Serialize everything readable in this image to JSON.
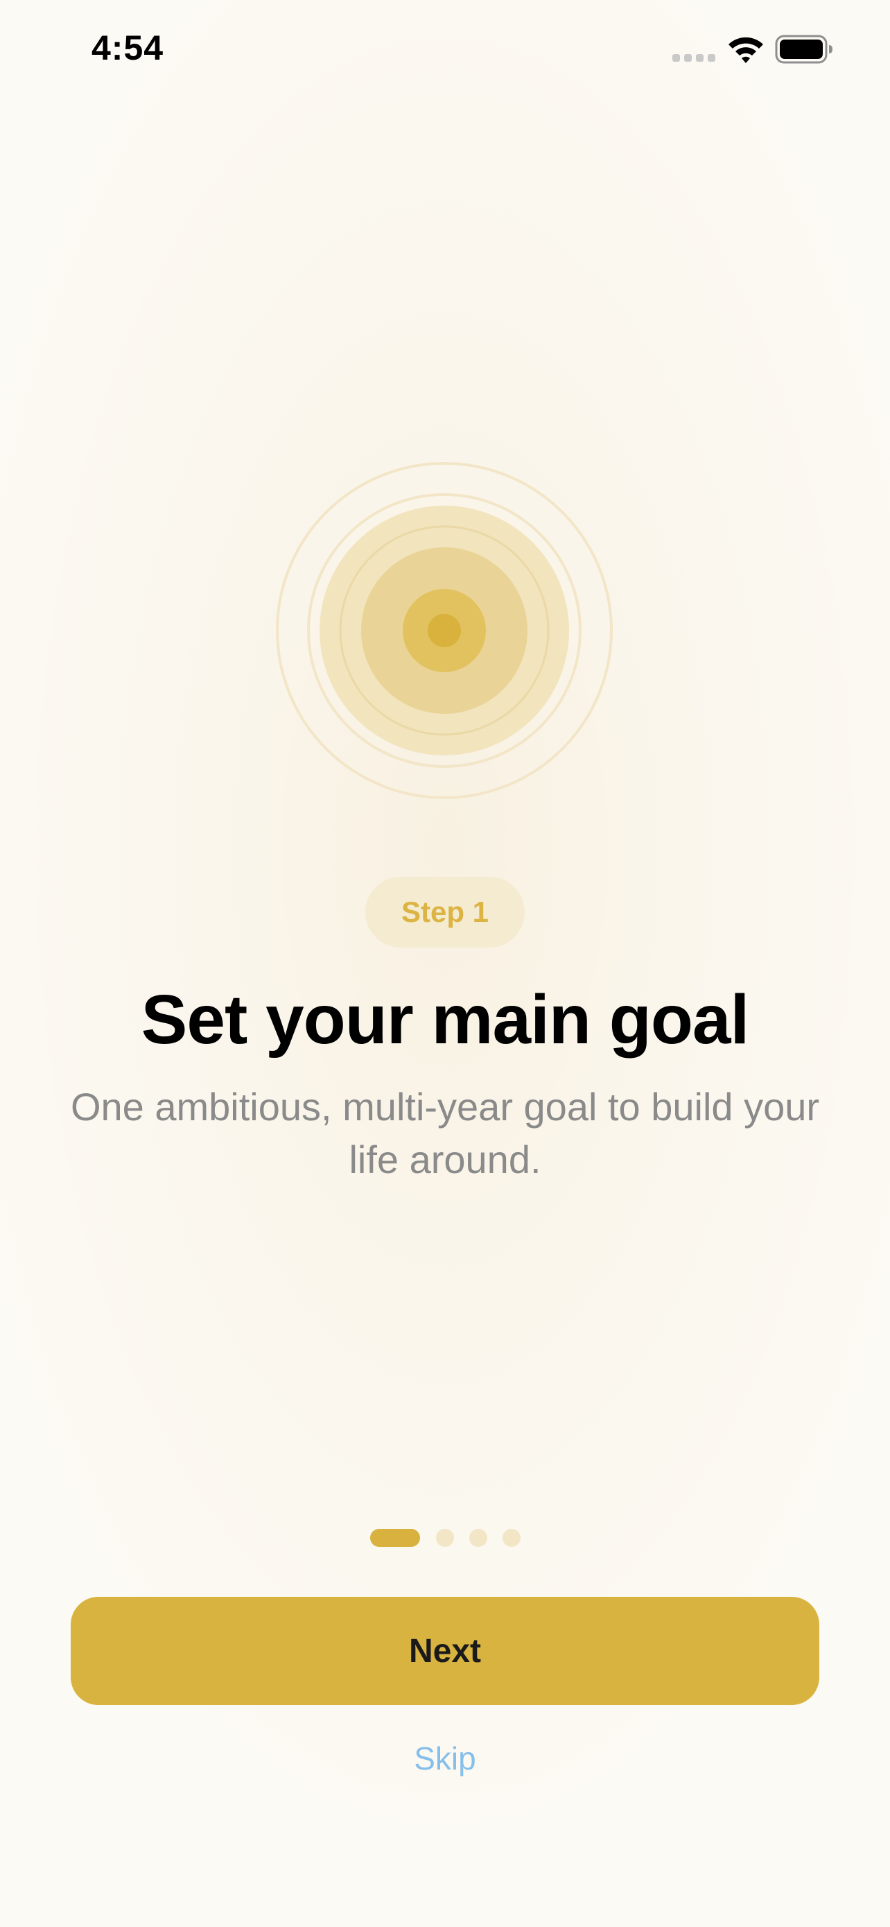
{
  "status_bar": {
    "time": "4:54"
  },
  "icons": {
    "signal": "cellular-signal-icon",
    "wifi": "wifi-icon",
    "battery": "battery-icon",
    "target": "target-icon"
  },
  "onboarding": {
    "step_label": "Step 1",
    "title": "Set your main goal",
    "subtitle": "One ambitious, multi-year goal to build your life around.",
    "page_index": 1,
    "page_count": 4
  },
  "actions": {
    "next_label": "Next",
    "skip_label": "Skip"
  },
  "colors": {
    "accent": "#d9b33f",
    "accent_soft": "#f5ebd0",
    "link": "#86bfe9",
    "subtitle": "#8a8a8a",
    "background": "#fcfaf5"
  }
}
